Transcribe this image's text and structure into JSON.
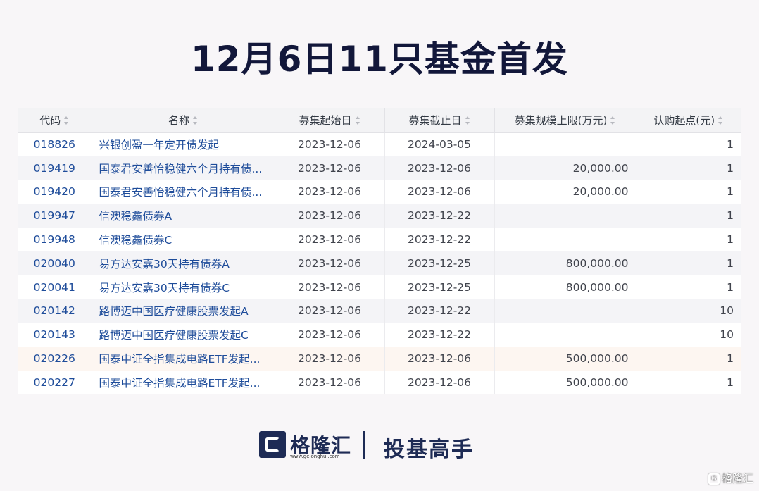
{
  "title": "12月6日11只基金首发",
  "table": {
    "columns": [
      "代码",
      "名称",
      "募集起始日",
      "募集截止日",
      "募集规模上限(万元)",
      "认购起点(元)"
    ],
    "rows": [
      {
        "code": "018826",
        "name": "兴银创盈一年定开债发起",
        "start": "2023-12-06",
        "end": "2024-03-05",
        "cap": "",
        "min": "1"
      },
      {
        "code": "019419",
        "name": "国泰君安善怡稳健六个月持有债...",
        "start": "2023-12-06",
        "end": "2023-12-06",
        "cap": "20,000.00",
        "min": "1"
      },
      {
        "code": "019420",
        "name": "国泰君安善怡稳健六个月持有债...",
        "start": "2023-12-06",
        "end": "2023-12-06",
        "cap": "20,000.00",
        "min": "1"
      },
      {
        "code": "019947",
        "name": "信澳稳鑫债券A",
        "start": "2023-12-06",
        "end": "2023-12-22",
        "cap": "",
        "min": "1"
      },
      {
        "code": "019948",
        "name": "信澳稳鑫债券C",
        "start": "2023-12-06",
        "end": "2023-12-22",
        "cap": "",
        "min": "1"
      },
      {
        "code": "020040",
        "name": "易方达安嘉30天持有债券A",
        "start": "2023-12-06",
        "end": "2023-12-25",
        "cap": "800,000.00",
        "min": "1"
      },
      {
        "code": "020041",
        "name": "易方达安嘉30天持有债券C",
        "start": "2023-12-06",
        "end": "2023-12-25",
        "cap": "800,000.00",
        "min": "1"
      },
      {
        "code": "020142",
        "name": "路博迈中国医疗健康股票发起A",
        "start": "2023-12-06",
        "end": "2023-12-22",
        "cap": "",
        "min": "10"
      },
      {
        "code": "020143",
        "name": "路博迈中国医疗健康股票发起C",
        "start": "2023-12-06",
        "end": "2023-12-22",
        "cap": "",
        "min": "10"
      },
      {
        "code": "020226",
        "name": "国泰中证全指集成电路ETF发起...",
        "start": "2023-12-06",
        "end": "2023-12-06",
        "cap": "500,000.00",
        "min": "1"
      },
      {
        "code": "020227",
        "name": "国泰中证全指集成电路ETF发起...",
        "start": "2023-12-06",
        "end": "2023-12-06",
        "cap": "500,000.00",
        "min": "1"
      }
    ],
    "highlighted_row": 9
  },
  "footer": {
    "brand": "格隆汇",
    "url": "www.gelonghui.com",
    "slogan": "投基高手"
  },
  "watermark": {
    "text": "格隆汇"
  },
  "colors": {
    "title": "#12173a",
    "link": "#1e4c9a",
    "brand": "#1e2b55",
    "highlight_row": "#fdf6f1"
  }
}
